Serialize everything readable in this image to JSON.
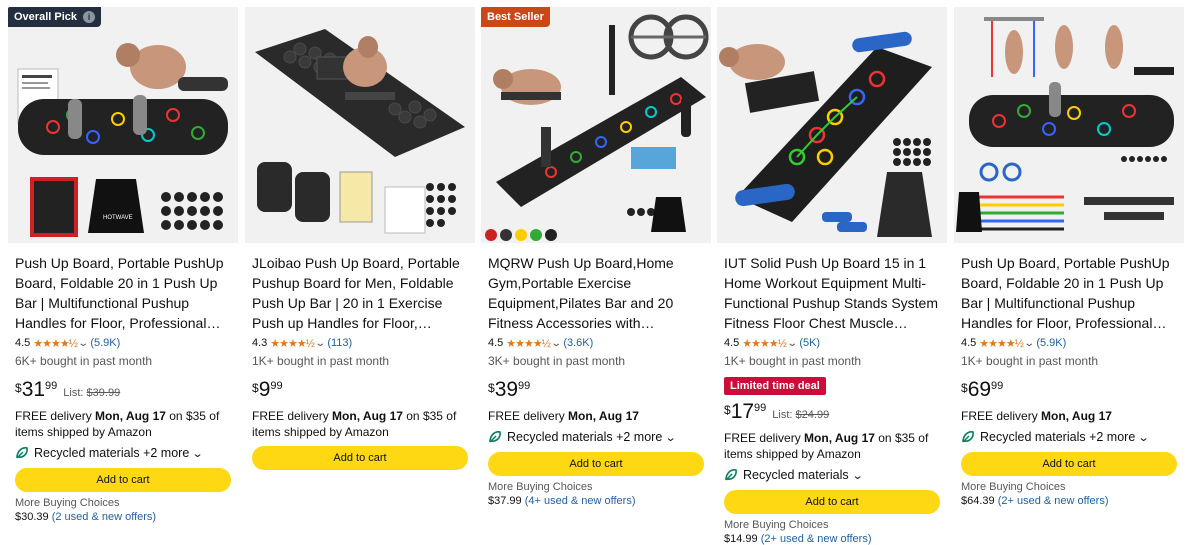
{
  "products": [
    {
      "badge": "Overall Pick",
      "title": "Push Up Board, Portable PushUp Board, Foldable 20 in 1 Push Up Bar | Multifunctional Pushup Handles for Floor, Professional Strength Trainin…",
      "rating": "4.5",
      "stars": "★★★★½",
      "reviews": "(5.9K)",
      "bought": "6K+ bought in past month",
      "price_symbol": "$",
      "price_whole": "31",
      "price_frac": "99",
      "list_label": "List:",
      "list_price": "$39.99",
      "delivery_pre": "FREE delivery ",
      "delivery_date": "Mon, Aug 17",
      "delivery_post": " on $35 of items shipped by Amazon",
      "recycled": "Recycled materials +2 more",
      "cart": "Add to cart",
      "mbc_label": "More Buying Choices",
      "mbc_price": "$30.39",
      "mbc_offers": "(2 used & new offers)"
    },
    {
      "title": "JLoibao Push Up Board, Portable Pushup Board for Men, Foldable Push Up Bar | 20 in 1 Exercise Push up Handles for Floor, Workout Home…",
      "rating": "4.3",
      "stars": "★★★★½",
      "reviews": "(113)",
      "bought": "1K+ bought in past month",
      "price_symbol": "$",
      "price_whole": "9",
      "price_frac": "99",
      "delivery_pre": "FREE delivery ",
      "delivery_date": "Mon, Aug 17",
      "delivery_post": " on $35 of items shipped by Amazon",
      "cart": "Add to cart"
    },
    {
      "badge": "Best Seller",
      "title": "MQRW Push Up Board,Home Gym,Portable Exercise Equipment,Pilates Bar and 20 Fitness Accessories with Resistance Bands…",
      "rating": "4.5",
      "stars": "★★★★½",
      "reviews": "(3.6K)",
      "bought": "3K+ bought in past month",
      "price_symbol": "$",
      "price_whole": "39",
      "price_frac": "99",
      "delivery_pre": "FREE delivery ",
      "delivery_date": "Mon, Aug 17",
      "recycled": "Recycled materials +2 more",
      "cart": "Add to cart",
      "mbc_label": "More Buying Choices",
      "mbc_price": "$37.99",
      "mbc_offers": "(4+ used & new offers)"
    },
    {
      "title": "IUT Solid Push Up Board 15 in 1 Home Workout Equipment Multi-Functional Pushup Stands System Fitness Floor Chest Muscle Exercise…",
      "rating": "4.5",
      "stars": "★★★★½",
      "reviews": "(5K)",
      "bought": "1K+ bought in past month",
      "deal": "Limited time deal",
      "price_symbol": "$",
      "price_whole": "17",
      "price_frac": "99",
      "list_label": "List:",
      "list_price": "$24.99",
      "delivery_pre": "FREE delivery ",
      "delivery_date": "Mon, Aug 17",
      "delivery_post": " on $35 of items shipped by Amazon",
      "recycled": "Recycled materials",
      "cart": "Add to cart",
      "mbc_label": "More Buying Choices",
      "mbc_price": "$14.99",
      "mbc_offers": "(2+ used & new offers)"
    },
    {
      "title": "Push Up Board, Portable PushUp Board, Foldable 20 in 1 Push Up Bar | Multifunctional Pushup Handles for Floor, Professional Strength Trainin…",
      "rating": "4.5",
      "stars": "★★★★½",
      "reviews": "(5.9K)",
      "bought": "1K+ bought in past month",
      "price_symbol": "$",
      "price_whole": "69",
      "price_frac": "99",
      "delivery_pre": "FREE delivery ",
      "delivery_date": "Mon, Aug 17",
      "recycled": "Recycled materials +2 more",
      "cart": "Add to cart",
      "mbc_label": "More Buying Choices",
      "mbc_price": "$64.39",
      "mbc_offers": "(2+ used & new offers)"
    }
  ],
  "colors": {
    "cart_button": "#ffd814",
    "link": "#2162a1",
    "star": "#de7921",
    "deal_badge": "#cc0c39",
    "best_seller_badge": "#cc4718",
    "overall_pick_badge": "#232f3e",
    "leaf": "#067d62"
  },
  "icons": {
    "info": "info-icon",
    "rating_dropdown": "chevron-down-icon",
    "recycled": "leaf-icon"
  }
}
